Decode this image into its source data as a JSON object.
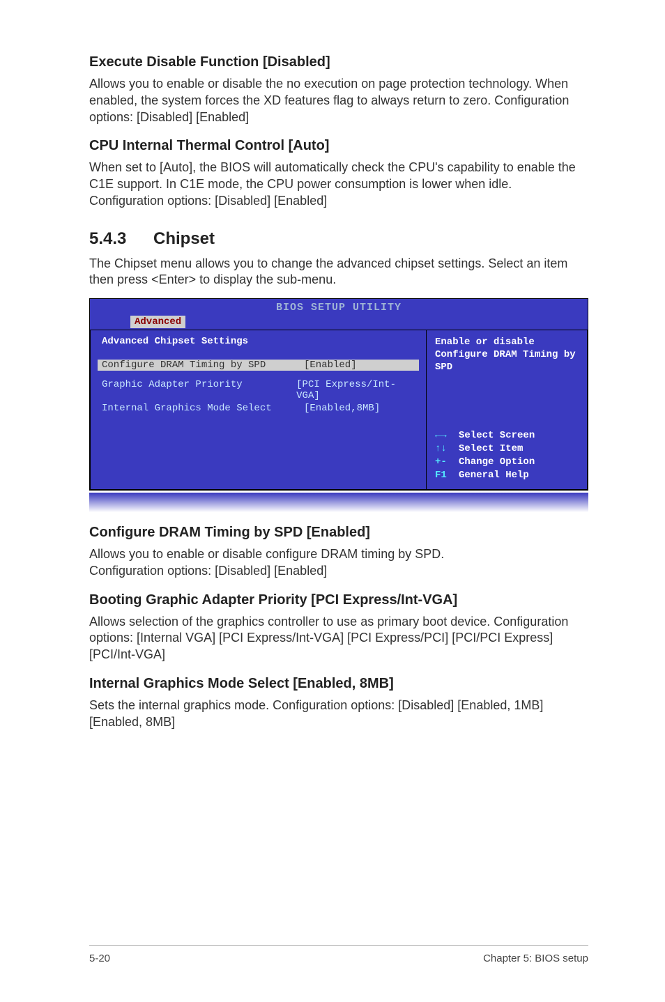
{
  "sec1": {
    "title": "Execute Disable Function [Disabled]",
    "body": "Allows you to enable or disable the no execution on page protection technology. When enabled, the system forces the XD features flag to always return to zero. Configuration options: [Disabled] [Enabled]"
  },
  "sec2": {
    "title": " CPU Internal Thermal Control [Auto]",
    "body": "When set to [Auto], the BIOS will automatically check the CPU's capability to enable the C1E support. In C1E mode, the CPU power consumption is lower when idle. Configuration options: [Disabled] [Enabled]"
  },
  "chipset": {
    "num": "5.4.3",
    "title": "Chipset",
    "intro": "The Chipset menu allows you to change the advanced chipset settings. Select an item then press <Enter> to display the sub-menu."
  },
  "bios": {
    "title": "BIOS SETUP UTILITY",
    "tab": "Advanced",
    "panel_title": "Advanced Chipset Settings",
    "rows": [
      {
        "label": "Configure DRAM Timing by SPD",
        "value": "[Enabled]",
        "selected": true
      },
      {
        "label": "Graphic Adapter Priority",
        "value": "[PCI Express/Int-VGA]",
        "selected": false
      },
      {
        "label": "Internal Graphics Mode Select",
        "value": "[Enabled,8MB]",
        "selected": false
      }
    ],
    "help": "Enable or disable Configure DRAM Timing by SPD",
    "nav": [
      {
        "key": "←→",
        "label": "Select Screen"
      },
      {
        "key": "↑↓",
        "label": "Select Item"
      },
      {
        "key": "+-",
        "label": "Change Option"
      },
      {
        "key": "F1",
        "label": "General Help"
      }
    ]
  },
  "sec3": {
    "title": "Configure DRAM Timing by SPD [Enabled]",
    "body1": "Allows you to enable or disable configure DRAM timing by SPD.",
    "body2": "Configuration options: [Disabled] [Enabled]"
  },
  "sec4": {
    "title": "Booting Graphic Adapter Priority [PCI Express/Int-VGA]",
    "body": "Allows selection of the graphics controller to use as primary boot device. Configuration options: [Internal VGA] [PCI Express/Int-VGA] [PCI Express/PCI] [PCI/PCI Express] [PCI/Int-VGA]"
  },
  "sec5": {
    "title": "Internal Graphics Mode Select [Enabled, 8MB]",
    "body": "Sets the internal graphics mode. Configuration options: [Disabled] [Enabled, 1MB] [Enabled, 8MB]"
  },
  "footer": {
    "page": "5-20",
    "chapter": "Chapter 5: BIOS setup"
  }
}
